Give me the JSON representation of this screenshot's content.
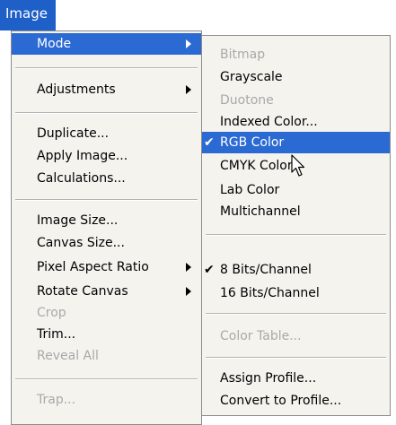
{
  "menubar": {
    "title": "Image"
  },
  "main_menu": {
    "mode": "Mode",
    "adjustments": "Adjustments",
    "duplicate": "Duplicate...",
    "apply_image": "Apply Image...",
    "calculations": "Calculations...",
    "image_size": "Image Size...",
    "canvas_size": "Canvas Size...",
    "pixel_aspect_ratio": "Pixel Aspect Ratio",
    "rotate_canvas": "Rotate Canvas",
    "crop": "Crop",
    "trim": "Trim...",
    "reveal_all": "Reveal All",
    "trap": "Trap..."
  },
  "mode_submenu": {
    "bitmap": "Bitmap",
    "grayscale": "Grayscale",
    "duotone": "Duotone",
    "indexed_color": "Indexed Color...",
    "rgb_color": "RGB Color",
    "cmyk_color": "CMYK Color",
    "lab_color": "Lab Color",
    "multichannel": "Multichannel",
    "bits8": "8 Bits/Channel",
    "bits16": "16 Bits/Channel",
    "color_table": "Color Table...",
    "assign_profile": "Assign Profile...",
    "convert_to_profile": "Convert to Profile...",
    "check_glyph": "✔"
  },
  "colors": {
    "highlight": "#2b6ad2",
    "menu_bg": "#f4f3ee",
    "disabled_text": "#a9a9a9"
  },
  "icons": [
    "submenu-arrow-icon",
    "checkmark-icon",
    "mouse-pointer-icon"
  ]
}
